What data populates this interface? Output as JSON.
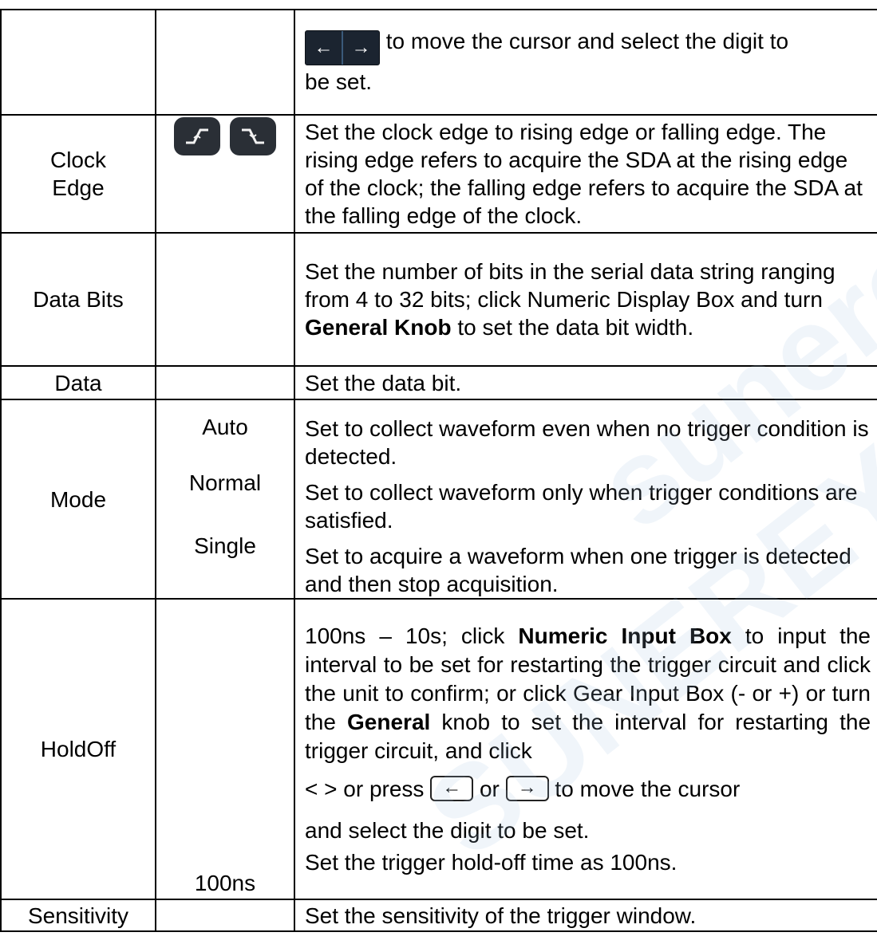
{
  "watermark": {
    "text1": "sunereye",
    "text2": "SUNEREYE"
  },
  "row_cursor": {
    "left_arrow": "←",
    "right_arrow": "→",
    "text_a": " to move the cursor and select the digit to",
    "text_b": "be set."
  },
  "row_clock_edge": {
    "label_line1": "Clock",
    "label_line2": "Edge",
    "icons": [
      "rising-edge-icon",
      "falling-edge-icon"
    ],
    "description": "Set the clock edge to rising edge or falling edge. The rising edge refers to acquire the SDA at the rising edge of the clock; the falling edge refers to acquire the SDA at the falling edge of the clock."
  },
  "row_data_bits": {
    "label": "Data Bits",
    "desc_a": "Set the number of bits in the serial data string ranging from 4 to 32 bits; click Numeric Display Box and turn ",
    "desc_bold": "General Knob",
    "desc_b": " to set the data bit width."
  },
  "row_data": {
    "label": "Data",
    "description": "Set the data bit."
  },
  "row_mode": {
    "label": "Mode",
    "options": [
      {
        "name": "Auto",
        "description": "Set to collect waveform even when no trigger condition is detected."
      },
      {
        "name": "Normal",
        "description": "Set to collect waveform only when trigger conditions are satisfied."
      },
      {
        "name": "Single",
        "description": "Set to acquire a waveform when one trigger is detected and then stop acquisition."
      }
    ]
  },
  "row_holdoff": {
    "label": "HoldOff",
    "desc_a": "100ns – 10s; click ",
    "desc_bold1": "Numeric Input Box",
    "desc_b": " to input the interval to be set for restarting the trigger circuit and click the unit to confirm; or click Gear Input Box (- or +) or turn the ",
    "desc_bold2": "General",
    "desc_c": " knob to set the interval for restarting the trigger circuit, and click",
    "desc_d": "< > or press ",
    "key_left": "←",
    "desc_or": " or ",
    "key_right": "→",
    "desc_e": " to move the cursor",
    "desc_f": "and select the digit to be set.",
    "option": "100ns",
    "option_description": "Set the trigger hold-off time as 100ns."
  },
  "row_sensitivity": {
    "label": "Sensitivity",
    "description": "Set the sensitivity of the trigger window."
  }
}
